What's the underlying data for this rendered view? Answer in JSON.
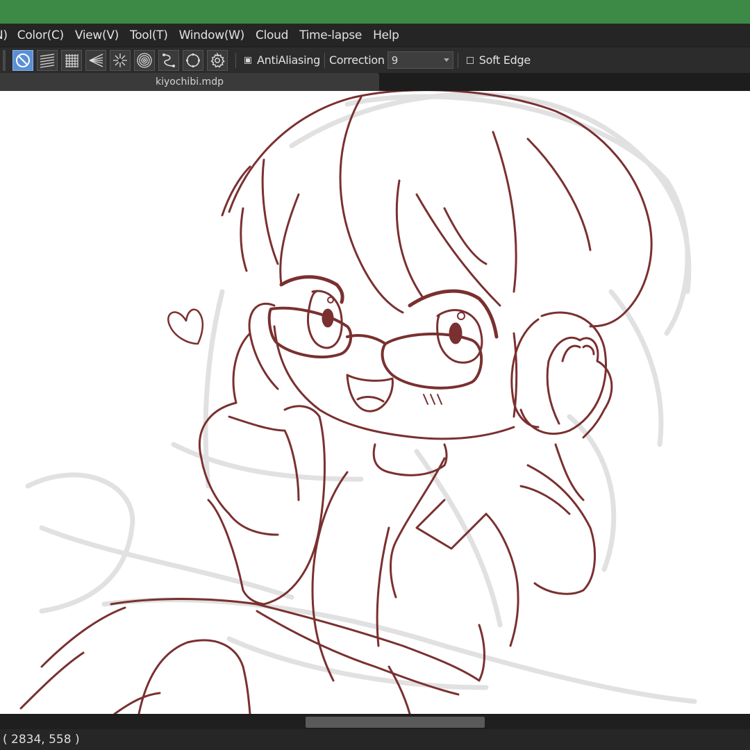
{
  "menu": {
    "items": [
      "N)",
      "Color(C)",
      "View(V)",
      "Tool(T)",
      "Window(W)",
      "Cloud",
      "Time-lapse",
      "Help"
    ]
  },
  "toolbar": {
    "ruler_buttons": [
      {
        "icon": "ruler-off-icon",
        "active": true
      },
      {
        "icon": "parallel-ruler-icon",
        "active": false
      },
      {
        "icon": "cross-ruler-icon",
        "active": false
      },
      {
        "icon": "vanishing-point-ruler-icon",
        "active": false
      },
      {
        "icon": "radial-ruler-icon",
        "active": false
      },
      {
        "icon": "concentric-ruler-icon",
        "active": false
      },
      {
        "icon": "curve-ruler-icon",
        "active": false
      },
      {
        "icon": "ellipse-ruler-icon",
        "active": false
      },
      {
        "icon": "gear-icon",
        "active": false
      }
    ],
    "antialiasing_label": "AntiAliasing",
    "antialiasing_checked": true,
    "correction_label": "Correction",
    "correction_value": "9",
    "soft_edge_label": "Soft Edge",
    "soft_edge_checked": false
  },
  "tabs": {
    "active_file": "kiyochibi.mdp"
  },
  "status": {
    "coordinates": "( 2834, 558 )"
  },
  "colors": {
    "title_bar": "#3c8a45",
    "active_tool": "#5a8fd6",
    "sketch_line": "#7a3030",
    "rough_sketch": "#d8d8d8"
  }
}
